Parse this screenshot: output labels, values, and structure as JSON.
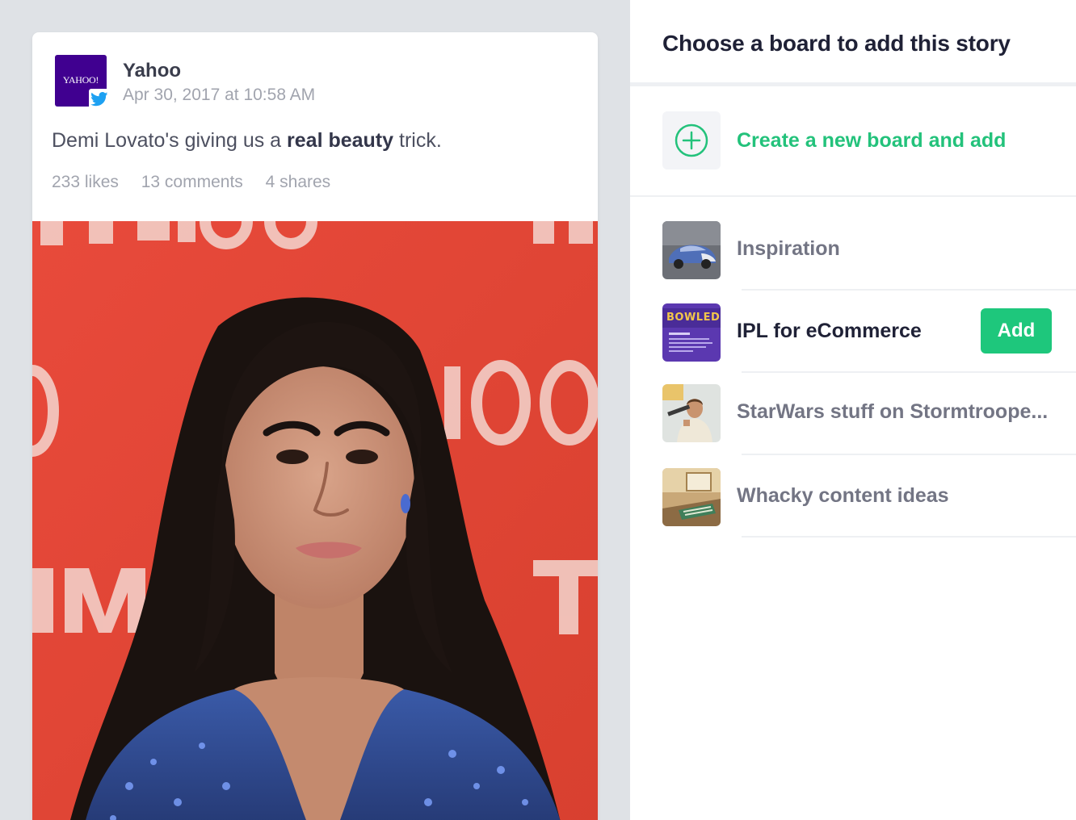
{
  "story": {
    "source": {
      "name": "Yahoo",
      "logo_text": "YAHOO!",
      "logo_color": "#400090",
      "network_icon": "twitter-icon",
      "network_color": "#1da1f2"
    },
    "date": "Apr 30, 2017 at 10:58 AM",
    "text": {
      "before": "Demi Lovato's giving us a ",
      "bold": "real beauty",
      "after": " trick."
    },
    "stats": {
      "likes": "233 likes",
      "comments": "13 comments",
      "shares": "4 shares"
    },
    "photo": {
      "backdrop_color": "#e4493a"
    }
  },
  "panel": {
    "title": "Choose a board to add this story",
    "create": {
      "label": "Create a new board and add",
      "icon": "plus-circle-icon",
      "accent": "#23c27b"
    },
    "boards": [
      {
        "name": "Inspiration",
        "thumb": "car-thumbnail"
      },
      {
        "name": "IPL for eCommerce",
        "thumb": "bowled-thumbnail",
        "thumb_text": "BOWLED",
        "add_label": "Add"
      },
      {
        "name": "StarWars stuff on Stormtroope...",
        "thumb": "starwars-thumbnail"
      },
      {
        "name": "Whacky content ideas",
        "thumb": "room-thumbnail"
      }
    ],
    "add_color": "#1ec77c"
  }
}
